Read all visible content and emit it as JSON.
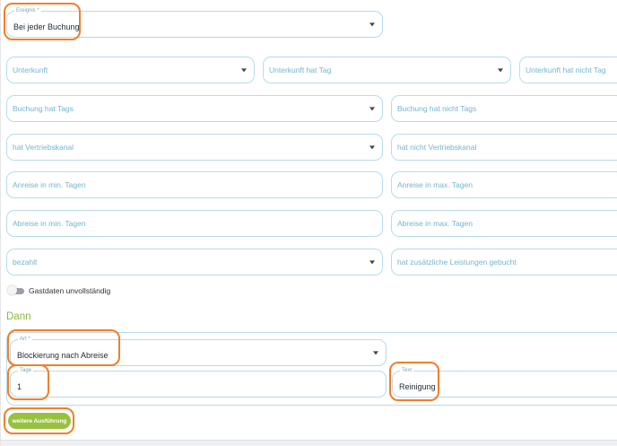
{
  "rule": {
    "trigger": {
      "label": "Ereignis *",
      "value": "Bei jeder Buchung"
    }
  },
  "conditions": {
    "unterkunft": "Unterkunft",
    "unterkunft_hat_tag": "Unterkunft hat Tag",
    "unterkunft_hat_nicht_tag": "Unterkunft hat nicht Tag",
    "buchung_hat_tags": "Buchung hat Tags",
    "buchung_hat_nicht_tags": "Buchung hat nicht Tags",
    "hat_vertriebskanal": "hat Vertriebskanal",
    "hat_nicht_vertriebskanal": "hat nicht Vertriebskanal",
    "anreise_min": "Anreise in min. Tagen",
    "anreise_max": "Anreise in max. Tagen",
    "abreise_min": "Abreise in min. Tagen",
    "abreise_max": "Abreise in max. Tagen",
    "bezahlt": "bezahlt",
    "zusaetzliche_leistungen": "hat zusätzliche Leistungen gebucht",
    "gastdaten_toggle": "Gastdaten unvollständig"
  },
  "action": {
    "section_title": "Dann",
    "art": {
      "label": "Art *",
      "value": "Blockierung nach Abreise"
    },
    "tage": {
      "label": "Tage",
      "value": "1"
    },
    "text": {
      "label": "Text",
      "value": "Reinigung"
    },
    "more_button": "weitere Ausführung"
  },
  "colors": {
    "accent_green": "#99c140",
    "field_border": "#b8dbe9",
    "placeholder": "#74b3d0",
    "highlight": "#f07f2a"
  }
}
